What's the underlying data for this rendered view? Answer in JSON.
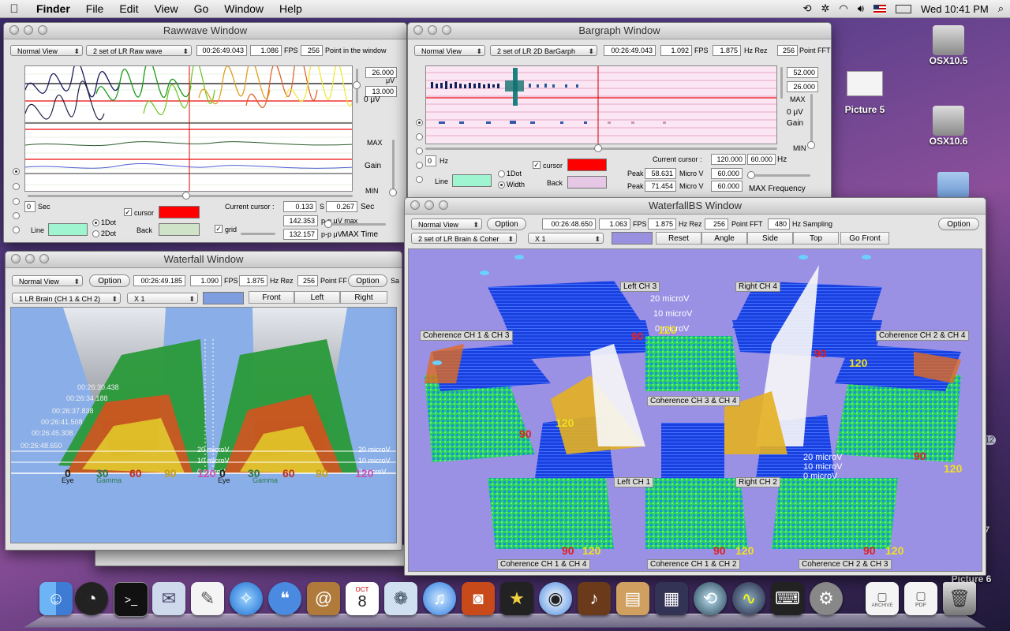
{
  "menubar": {
    "items": [
      "Finder",
      "File",
      "Edit",
      "View",
      "Go",
      "Window",
      "Help"
    ],
    "clock": "Wed 10:41 PM"
  },
  "desktop": {
    "icons": [
      "OSX10.5",
      "Picture 5",
      "OSX10.6",
      "Picture 6"
    ],
    "partial_labels": [
      "12",
      "7"
    ]
  },
  "rawwave": {
    "title": "Rawwave Window",
    "view": "Normal View",
    "set": "2 set of LR Raw wave",
    "time": "00:26:49.043",
    "fps": "1.086",
    "fps_label": "FPS",
    "points": "256",
    "points_label": "Point in the window",
    "gain_top": "26.000",
    "gain_unit": "μV",
    "gain_mid": "13.000",
    "gain_zero": "0 μV",
    "max": "MAX",
    "gain": "Gain",
    "min": "MIN",
    "sec_val": "0",
    "sec_label": "Sec",
    "cursor_label": "cursor",
    "back_label": "Back",
    "line_label": "Line",
    "dot1": "1Dot",
    "dot2": "2Dot",
    "grid_label": "grid",
    "current_cursor_label": "Current cursor :",
    "current_cursor": "0.133",
    "s_label": "S",
    "sec2": "0.267",
    "sec2_label": "Sec",
    "pp_max": "142.353",
    "pp_max_label": "p-p μV max",
    "pp": "132.157",
    "pp_label": "p-p μV",
    "max_time": "MAX Time",
    "colors": {
      "cursor": "#ff0000",
      "back": "#cfe3c8",
      "line": "#9ff5cf"
    }
  },
  "bargraph": {
    "title": "Bargraph Window",
    "view": "Normal View",
    "set": "2 set of LR 2D BarGarph",
    "time": "00:26:49.043",
    "fps": "1.092",
    "fps_label": "FPS",
    "hz_rez": "1.875",
    "hz_rez_label": "Hz Rez",
    "points": "256",
    "points_label": "Point FFT",
    "val_top": "52.000",
    "val_2": "26.000",
    "max": "MAX",
    "zero": "0 μV",
    "gain": "Gain",
    "min": "MIN",
    "hz_val": "0",
    "hz_label": "Hz",
    "cursor_label": "cursor",
    "back_label": "Back",
    "line_label": "Line",
    "dot1": "1Dot",
    "width": "Width",
    "current_cursor_label": "Current cursor :",
    "current_cursor": "120.000",
    "hz2": "60.000",
    "hz2_label": "Hz",
    "peak1": "58.631",
    "peak2": "71.454",
    "peak_label": "Peak",
    "microv": "Micro V",
    "hz_a": "60.000",
    "hz_b": "60.000",
    "max_freq": "MAX Frequency",
    "colors": {
      "cursor": "#ff0000",
      "back": "#e6c8e6",
      "line": "#9ff5cf"
    }
  },
  "waterfall": {
    "title": "Waterfall Window",
    "view": "Normal View",
    "option": "Option",
    "time": "00:26:49.185",
    "fps": "1.090",
    "fps_label": "FPS",
    "hz_rez": "1.875",
    "hz_rez_label": "Hz Rez",
    "points": "256",
    "points_label": "Point FF",
    "option2": "Option",
    "sa": "Sa",
    "channel": "1 LR Brain (CH 1 & CH 2)",
    "zoom": "X 1",
    "front": "Front",
    "left": "Left",
    "right": "Right",
    "timestamps": [
      "00:26:30.438",
      "00:26:34.188",
      "00:26:37.838",
      "00:26:41.508",
      "00:26:45.308",
      "00:26:48.650"
    ],
    "axis_ticks": [
      "0",
      "30",
      "60",
      "90",
      "120"
    ],
    "band_labels": [
      "Eye",
      "Gamma"
    ],
    "scale_labels": [
      "20 microV",
      "10 microV",
      "0 microV"
    ]
  },
  "waterfallbs": {
    "title": "WaterfallBS Window",
    "view": "Normal View",
    "option": "Option",
    "time": "00:26:48.650",
    "fps": "1.063",
    "fps_label": "FPS",
    "hz_rez": "1.875",
    "hz_rez_label": "Hz Rez",
    "points": "256",
    "points_label": "Point FFT",
    "sampling": "480",
    "sampling_label": "Hz Sampling",
    "option2": "Option",
    "set": "2 set of LR Brain & Coher",
    "zoom": "X 1",
    "reset": "Reset",
    "angle": "Angle",
    "side": "Side",
    "top": "Top",
    "go_front": "Go Front",
    "panels": [
      "Left CH 3",
      "Right CH 4",
      "Coherence CH 1 & CH 3",
      "Coherence CH 2 & CH 4",
      "Coherence CH 3 & CH 4",
      "Left CH 1",
      "Right CH 2",
      "Coherence CH 1 & CH 4",
      "Coherence CH 1 & CH 2",
      "Coherence CH 2 & CH 3"
    ],
    "scale_labels": [
      "20 microV",
      "10 microV",
      "0 microV"
    ],
    "ticks": [
      "90",
      "120"
    ]
  },
  "dock": {
    "items": [
      "finder-icon",
      "dashboard-icon",
      "terminal-icon",
      "mail-icon",
      "textedit-icon",
      "safari-icon",
      "ichat-icon",
      "addressbook-icon",
      "ical-icon",
      "iphoto-icon",
      "itunes-icon",
      "photobooth-icon",
      "imovie-icon",
      "dvd-icon",
      "garageband-icon",
      "preview-icon",
      "spaces-icon",
      "timemachine-icon",
      "brainwave-icon",
      "keyboard-icon",
      "systemprefs-icon",
      "archive-icon",
      "pdf-icon",
      "trash-icon"
    ],
    "archive_label": "ARCHIVE",
    "pdf_label": "PDF",
    "ical_day": "8",
    "ical_month": "OCT"
  }
}
